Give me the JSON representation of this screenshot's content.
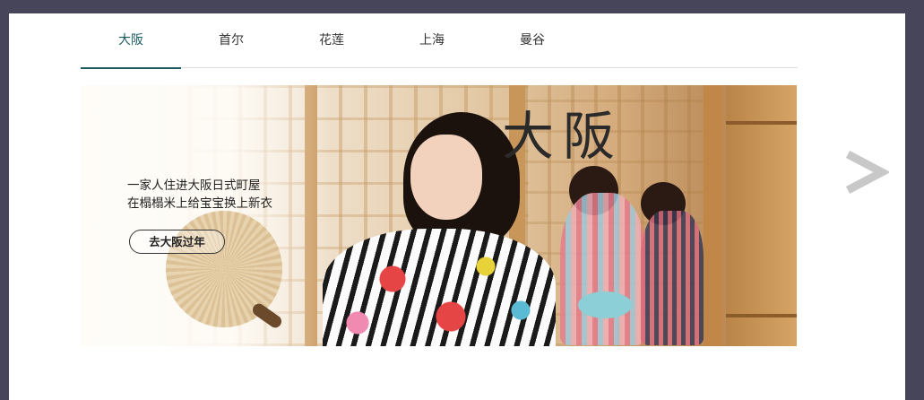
{
  "tabs": [
    {
      "label": "大阪",
      "active": true
    },
    {
      "label": "首尔",
      "active": false
    },
    {
      "label": "花莲",
      "active": false
    },
    {
      "label": "上海",
      "active": false
    },
    {
      "label": "曼谷",
      "active": false
    }
  ],
  "banner": {
    "title": "大阪",
    "subtitle_line1": "一家人住进大阪日式町屋",
    "subtitle_line2": "在榻榻米上给宝宝换上新衣",
    "cta_label": "去大阪过年"
  },
  "carousel": {
    "prev_icon": "chevron-left-icon",
    "next_icon": "chevron-right-icon"
  },
  "colors": {
    "outer_background": "#474559",
    "accent": "#1a5a5f",
    "arrow": "#c8c8c8"
  }
}
